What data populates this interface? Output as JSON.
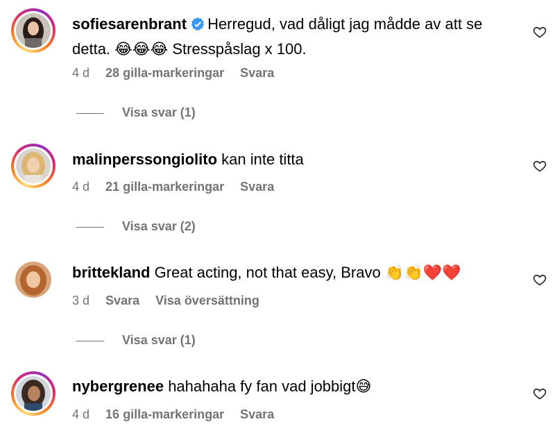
{
  "comments": [
    {
      "username": "sofiesarenbrant",
      "verified": true,
      "text": "Herregud, vad dåligt jag mådde av att se detta. 😂😂😂 Stresspåslag x 100.",
      "time": "4 d",
      "likes": "28 gilla-markeringar",
      "reply": "Svara",
      "view_replies": "Visa svar (1)",
      "avatar": "avatar-dark-hair-woman",
      "story_ring": true
    },
    {
      "username": "malinperssongiolito",
      "verified": false,
      "text": "kan inte titta",
      "time": "4 d",
      "likes": "21 gilla-markeringar",
      "reply": "Svara",
      "view_replies": "Visa svar (2)",
      "avatar": "avatar-blonde-woman",
      "story_ring": true
    },
    {
      "username": "brittekland",
      "verified": false,
      "text": "Great acting, not that easy, Bravo 👏👏❤️❤️",
      "time": "3 d",
      "reply": "Svara",
      "translate": "Visa översättning",
      "view_replies": "Visa svar (1)",
      "avatar": "avatar-redhead-woman",
      "story_ring": false
    },
    {
      "username": "nybergrenee",
      "verified": false,
      "text": "hahahaha fy fan vad jobbigt😅",
      "time": "4 d",
      "likes": "16 gilla-markeringar",
      "reply": "Svara",
      "avatar": "avatar-dark-curly-woman",
      "story_ring": true
    }
  ],
  "colors": {
    "meta_gray": "#737373",
    "verified_blue": "#3897f0",
    "story_gradient": [
      "#feda75",
      "#fa7e1e",
      "#d62976",
      "#962fbf"
    ]
  },
  "icons": {
    "like": "heart-outline-icon",
    "verified": "verified-badge-icon"
  }
}
